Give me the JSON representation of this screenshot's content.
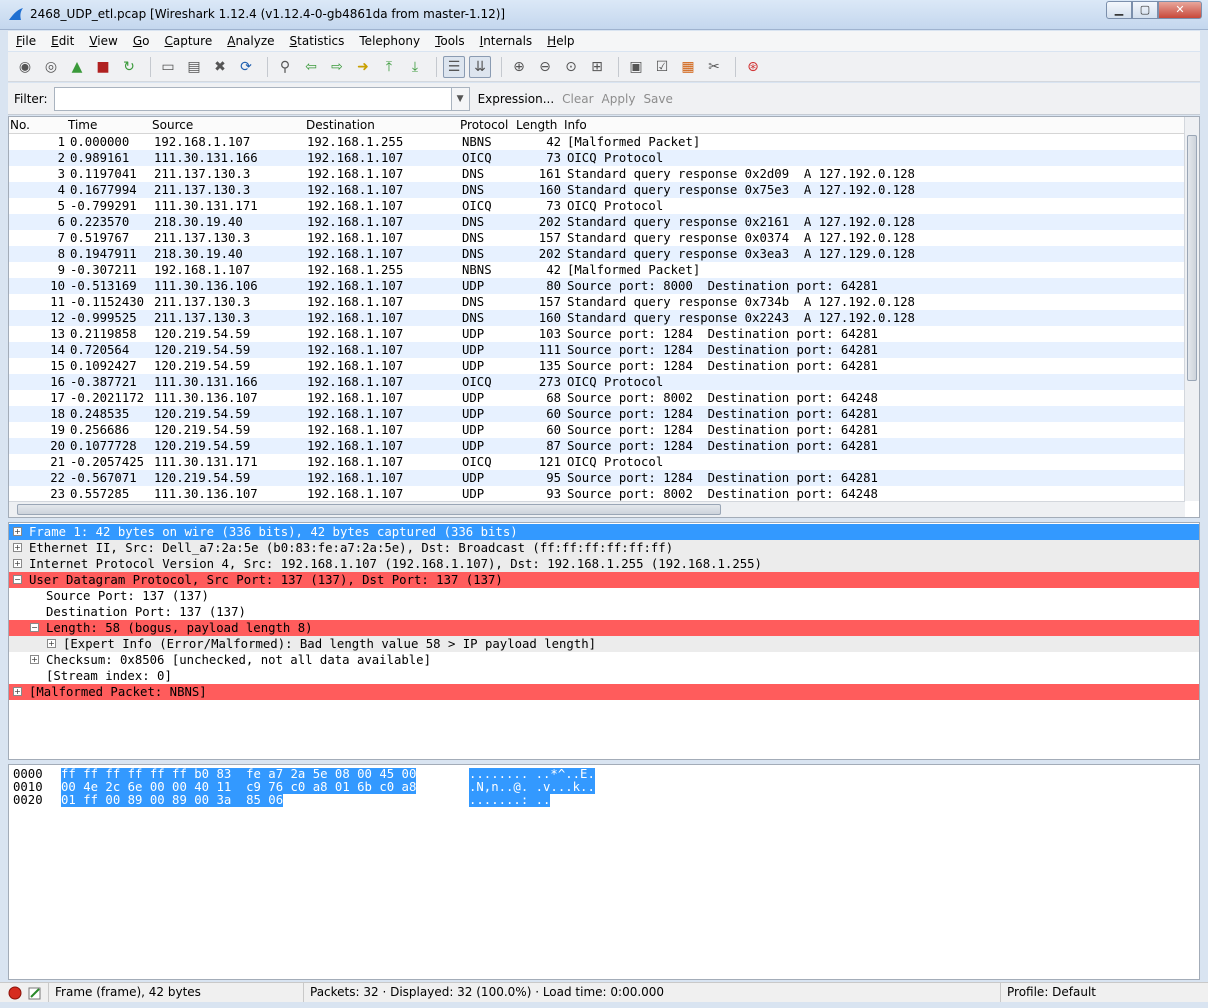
{
  "window": {
    "title": "2468_UDP_etl.pcap   [Wireshark 1.12.4  (v1.12.4-0-gb4861da from master-1.12)]",
    "minimize": "▁",
    "maximize": "▢",
    "close": "✕"
  },
  "menu": [
    {
      "key": "F",
      "rest": "ile"
    },
    {
      "key": "E",
      "rest": "dit"
    },
    {
      "key": "V",
      "rest": "iew"
    },
    {
      "key": "G",
      "rest": "o"
    },
    {
      "key": "C",
      "rest": "apture"
    },
    {
      "key": "A",
      "rest": "nalyze"
    },
    {
      "key": "S",
      "rest": "tatistics"
    },
    {
      "key": "",
      "rest": "Telephony"
    },
    {
      "key": "T",
      "rest": "ools"
    },
    {
      "key": "I",
      "rest": "nternals"
    },
    {
      "key": "H",
      "rest": "elp"
    }
  ],
  "toolbar": {
    "icons": [
      "interfaces-icon",
      "options-icon",
      "start-capture-icon",
      "stop-capture-icon",
      "restart-capture-icon",
      "open-file-icon",
      "save-file-icon",
      "close-file-icon",
      "reload-icon",
      "find-icon",
      "back-icon",
      "forward-icon",
      "goto-packet-icon",
      "first-packet-icon",
      "last-packet-icon",
      "colorize-icon",
      "autoscroll-icon",
      "zoom-in-icon",
      "zoom-out-icon",
      "zoom-normal-icon",
      "resize-columns-icon",
      "capture-filters-icon",
      "display-filters-icon",
      "coloring-rules-icon",
      "preferences-icon",
      "help-icon"
    ]
  },
  "filter": {
    "label": "Filter:",
    "value": "",
    "expression": "Expression...",
    "clear": "Clear",
    "apply": "Apply",
    "save": "Save"
  },
  "packet_list": {
    "columns": [
      "No.",
      "Time",
      "Source",
      "Destination",
      "Protocol",
      "Length",
      "Info"
    ],
    "rows": [
      [
        "1",
        "0.000000",
        "192.168.1.107",
        "192.168.1.255",
        "NBNS",
        "42",
        "[Malformed Packet]"
      ],
      [
        "2",
        "0.989161",
        "111.30.131.166",
        "192.168.1.107",
        "OICQ",
        "73",
        "OICQ Protocol"
      ],
      [
        "3",
        "0.1197041",
        "211.137.130.3",
        "192.168.1.107",
        "DNS",
        "161",
        "Standard query response 0x2d09  A 127.192.0.128"
      ],
      [
        "4",
        "0.1677994",
        "211.137.130.3",
        "192.168.1.107",
        "DNS",
        "160",
        "Standard query response 0x75e3  A 127.192.0.128"
      ],
      [
        "5",
        "-0.799291",
        "111.30.131.171",
        "192.168.1.107",
        "OICQ",
        "73",
        "OICQ Protocol"
      ],
      [
        "6",
        "0.223570",
        "218.30.19.40",
        "192.168.1.107",
        "DNS",
        "202",
        "Standard query response 0x2161  A 127.192.0.128"
      ],
      [
        "7",
        "0.519767",
        "211.137.130.3",
        "192.168.1.107",
        "DNS",
        "157",
        "Standard query response 0x0374  A 127.192.0.128"
      ],
      [
        "8",
        "0.1947911",
        "218.30.19.40",
        "192.168.1.107",
        "DNS",
        "202",
        "Standard query response 0x3ea3  A 127.129.0.128"
      ],
      [
        "9",
        "-0.307211",
        "192.168.1.107",
        "192.168.1.255",
        "NBNS",
        "42",
        "[Malformed Packet]"
      ],
      [
        "10",
        "-0.513169",
        "111.30.136.106",
        "192.168.1.107",
        "UDP",
        "80",
        "Source port: 8000  Destination port: 64281"
      ],
      [
        "11",
        "-0.1152430",
        "211.137.130.3",
        "192.168.1.107",
        "DNS",
        "157",
        "Standard query response 0x734b  A 127.192.0.128"
      ],
      [
        "12",
        "-0.999525",
        "211.137.130.3",
        "192.168.1.107",
        "DNS",
        "160",
        "Standard query response 0x2243  A 127.192.0.128"
      ],
      [
        "13",
        "0.2119858",
        "120.219.54.59",
        "192.168.1.107",
        "UDP",
        "103",
        "Source port: 1284  Destination port: 64281"
      ],
      [
        "14",
        "0.720564",
        "120.219.54.59",
        "192.168.1.107",
        "UDP",
        "111",
        "Source port: 1284  Destination port: 64281"
      ],
      [
        "15",
        "0.1092427",
        "120.219.54.59",
        "192.168.1.107",
        "UDP",
        "135",
        "Source port: 1284  Destination port: 64281"
      ],
      [
        "16",
        "-0.387721",
        "111.30.131.166",
        "192.168.1.107",
        "OICQ",
        "273",
        "OICQ Protocol"
      ],
      [
        "17",
        "-0.2021172",
        "111.30.136.107",
        "192.168.1.107",
        "UDP",
        "68",
        "Source port: 8002  Destination port: 64248"
      ],
      [
        "18",
        "0.248535",
        "120.219.54.59",
        "192.168.1.107",
        "UDP",
        "60",
        "Source port: 1284  Destination port: 64281"
      ],
      [
        "19",
        "0.256686",
        "120.219.54.59",
        "192.168.1.107",
        "UDP",
        "60",
        "Source port: 1284  Destination port: 64281"
      ],
      [
        "20",
        "0.1077728",
        "120.219.54.59",
        "192.168.1.107",
        "UDP",
        "87",
        "Source port: 1284  Destination port: 64281"
      ],
      [
        "21",
        "-0.2057425",
        "111.30.131.171",
        "192.168.1.107",
        "OICQ",
        "121",
        "OICQ Protocol"
      ],
      [
        "22",
        "-0.567071",
        "120.219.54.59",
        "192.168.1.107",
        "UDP",
        "95",
        "Source port: 1284  Destination port: 64281"
      ],
      [
        "23",
        "0.557285",
        "111.30.136.107",
        "192.168.1.107",
        "UDP",
        "93",
        "Source port: 8002  Destination port: 64248"
      ]
    ]
  },
  "detail_tree": [
    {
      "text": "Frame 1: 42 bytes on wire (336 bits), 42 bytes captured (336 bits)",
      "indent": 0,
      "expander": "+",
      "style": "blue"
    },
    {
      "text": "Ethernet II, Src: Dell_a7:2a:5e (b0:83:fe:a7:2a:5e), Dst: Broadcast (ff:ff:ff:ff:ff:ff)",
      "indent": 0,
      "expander": "+",
      "style": "grey"
    },
    {
      "text": "Internet Protocol Version 4, Src: 192.168.1.107 (192.168.1.107), Dst: 192.168.1.255 (192.168.1.255)",
      "indent": 0,
      "expander": "+",
      "style": "grey"
    },
    {
      "text": "User Datagram Protocol, Src Port: 137 (137), Dst Port: 137 (137)",
      "indent": 0,
      "expander": "−",
      "style": "red"
    },
    {
      "text": "Source Port: 137 (137)",
      "indent": 1,
      "expander": "",
      "style": ""
    },
    {
      "text": "Destination Port: 137 (137)",
      "indent": 1,
      "expander": "",
      "style": ""
    },
    {
      "text": "Length: 58 (bogus, payload length 8)",
      "indent": 1,
      "expander": "−",
      "style": "red"
    },
    {
      "text": "[Expert Info (Error/Malformed): Bad length value 58 > IP payload length]",
      "indent": 2,
      "expander": "+",
      "style": "grey"
    },
    {
      "text": "Checksum: 0x8506 [unchecked, not all data available]",
      "indent": 1,
      "expander": "+",
      "style": ""
    },
    {
      "text": "[Stream index: 0]",
      "indent": 1,
      "expander": "",
      "style": ""
    },
    {
      "text": "[Malformed Packet: NBNS]",
      "indent": 0,
      "expander": "+",
      "style": "red"
    }
  ],
  "hex_dump": [
    {
      "offset": "0000",
      "bytes": "ff ff ff ff ff ff b0 83  fe a7 2a 5e 08 00 45 00",
      "ascii": "........ ..*^..E."
    },
    {
      "offset": "0010",
      "bytes": "00 4e 2c 6e 00 00 40 11  c9 76 c0 a8 01 6b c0 a8",
      "ascii": ".N,n..@. .v...k.."
    },
    {
      "offset": "0020",
      "bytes": "01 ff 00 89 00 89 00 3a  85 06",
      "ascii": ".......: .."
    }
  ],
  "status": {
    "frame": "Frame (frame), 42 bytes",
    "packets": "Packets: 32 · Displayed: 32 (100.0%)  · Load time: 0:00.000",
    "profile": "Profile: Default"
  },
  "colors": {
    "selected_blue": "#3399ff",
    "malformed_red": "#ff5c5c",
    "row_alt": "#e7f1ff"
  }
}
